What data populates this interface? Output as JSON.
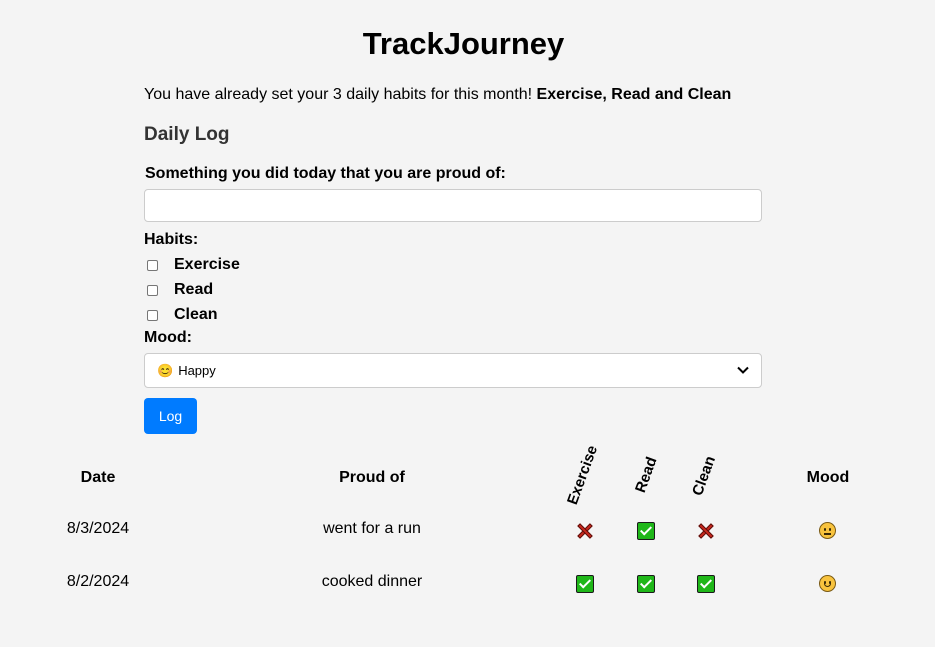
{
  "app": {
    "title": "TrackJourney"
  },
  "intro": {
    "text": "You have already set your 3 daily habits for this month! ",
    "habits_bold": "Exercise, Read and Clean"
  },
  "daily_log": {
    "heading": "Daily Log",
    "proud_label": "Something you did today that you are proud of:",
    "proud_value": "",
    "habits_label": "Habits:",
    "habits": [
      {
        "label": "Exercise",
        "checked": false
      },
      {
        "label": "Read",
        "checked": false
      },
      {
        "label": "Clean",
        "checked": false
      }
    ],
    "mood_label": "Mood:",
    "mood_selected": "Happy",
    "mood_selected_icon": "smile-emoji",
    "log_button": "Log"
  },
  "table": {
    "headers": {
      "date": "Date",
      "proud": "Proud of",
      "exercise": "Exercise",
      "read": "Read",
      "clean": "Clean",
      "mood": "Mood"
    },
    "rows": [
      {
        "date": "8/3/2024",
        "proud": "went for a run",
        "exercise": false,
        "read": true,
        "clean": false,
        "mood": "neutral-face-icon"
      },
      {
        "date": "8/2/2024",
        "proud": "cooked dinner",
        "exercise": true,
        "read": true,
        "clean": true,
        "mood": "smiling-face-icon"
      }
    ]
  },
  "colors": {
    "primary_button": "#007bff",
    "check_green": "#1fb719",
    "cross_red": "#c9271d",
    "background": "#f4f4f4"
  }
}
